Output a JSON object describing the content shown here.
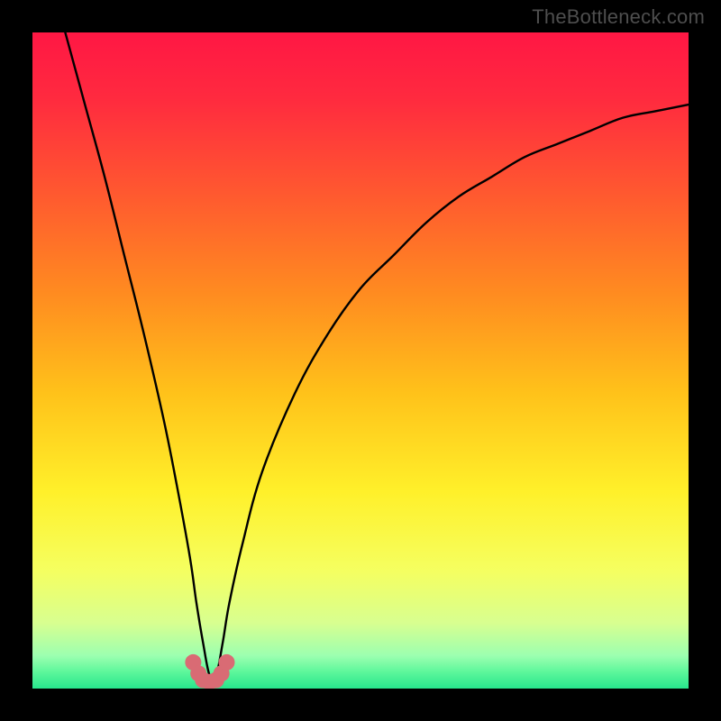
{
  "watermark": {
    "text": "TheBottleneck.com"
  },
  "colors": {
    "frame": "#000000",
    "curve": "#000000",
    "marker_fill": "#d96b74",
    "marker_stroke": "#d96b74",
    "watermark": "#4e4e4e",
    "gradient_stops": [
      {
        "offset": 0.0,
        "color": "#ff1744"
      },
      {
        "offset": 0.1,
        "color": "#ff2a3f"
      },
      {
        "offset": 0.25,
        "color": "#ff5a2f"
      },
      {
        "offset": 0.4,
        "color": "#ff8c20"
      },
      {
        "offset": 0.55,
        "color": "#ffc21a"
      },
      {
        "offset": 0.7,
        "color": "#fff02a"
      },
      {
        "offset": 0.82,
        "color": "#f5ff60"
      },
      {
        "offset": 0.9,
        "color": "#d8ff90"
      },
      {
        "offset": 0.95,
        "color": "#9cffb0"
      },
      {
        "offset": 0.975,
        "color": "#5cf79b"
      },
      {
        "offset": 1.0,
        "color": "#28e58c"
      }
    ]
  },
  "chart_data": {
    "type": "line",
    "title": "",
    "xlabel": "",
    "ylabel": "",
    "xlim": [
      0,
      100
    ],
    "ylim": [
      0,
      100
    ],
    "x_min_point": 27,
    "series": [
      {
        "name": "bottleneck-curve",
        "x": [
          5,
          8,
          11,
          14,
          17,
          20,
          22,
          24,
          25,
          26,
          27,
          28,
          29,
          30,
          32,
          35,
          40,
          45,
          50,
          55,
          60,
          65,
          70,
          75,
          80,
          85,
          90,
          95,
          100
        ],
        "values": [
          100,
          89,
          78,
          66,
          54,
          41,
          31,
          20,
          13,
          7,
          2,
          2,
          7,
          13,
          22,
          33,
          45,
          54,
          61,
          66,
          71,
          75,
          78,
          81,
          83,
          85,
          87,
          88,
          89
        ]
      }
    ],
    "markers": {
      "name": "valley-markers",
      "x": [
        24.5,
        25.3,
        26.0,
        27.0,
        28.0,
        28.8,
        29.6
      ],
      "values": [
        4.0,
        2.3,
        1.3,
        1.0,
        1.3,
        2.3,
        4.0
      ]
    }
  }
}
